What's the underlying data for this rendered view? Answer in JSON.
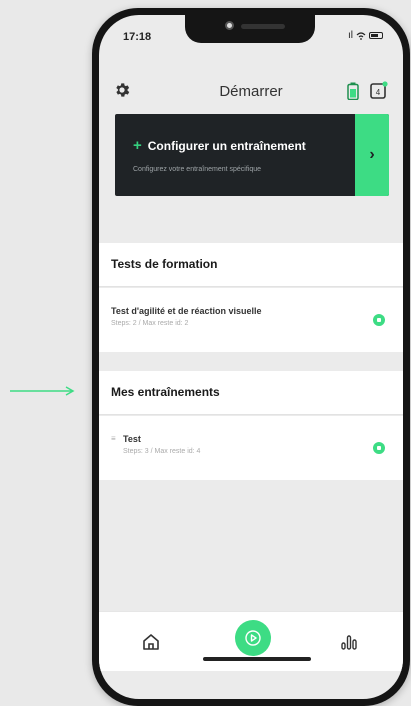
{
  "status_bar": {
    "time": "17:18",
    "signal": "ıl"
  },
  "header": {
    "title": "Démarrer"
  },
  "config_card": {
    "title": "Configurer un entraînement",
    "subtitle": "Configurez votre entraînement spécifique",
    "plus": "+",
    "chevron": "›"
  },
  "training_tests": {
    "title": "Tests de formation",
    "items": [
      {
        "name": "Test d'agilité et de réaction visuelle",
        "meta": "Steps: 2 / Max reste id: 2"
      }
    ]
  },
  "my_trainings": {
    "title": "Mes entraînements",
    "items": [
      {
        "name": "Test",
        "meta": "Steps: 3 / Max reste id: 4",
        "handle": "≡"
      }
    ]
  },
  "colors": {
    "accent": "#3ddc84",
    "card_dark": "#1f2326",
    "arrow": "#3ddc84"
  }
}
